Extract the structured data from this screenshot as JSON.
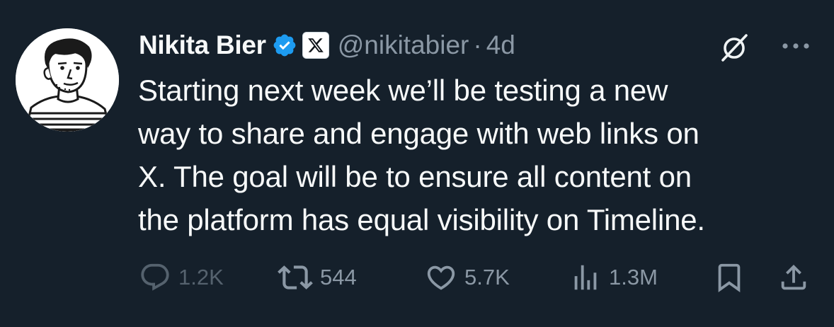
{
  "author": {
    "name": "Nikita Bier",
    "handle": "@nikitabier",
    "separator": "·",
    "time": "4d"
  },
  "icons": {
    "avatar": "avatar-illustration",
    "verified": "verified-badge-icon",
    "affiliate": "x-logo-icon",
    "grok": "grok-icon",
    "more": "more-icon"
  },
  "tweet": {
    "lines": [
      "Starting next week we’ll be testing a new",
      "way to share and engage with web links on",
      "X. The goal will be to ensure all content on",
      "the platform has equal visibility on Timeline."
    ]
  },
  "actions": {
    "replies": "1.2K",
    "retweets": "544",
    "likes": "5.7K",
    "views": "1.3M"
  },
  "colors": {
    "background": "#15202b",
    "text": "#f7f9f9",
    "secondary": "#8b98a5",
    "verified": "#1d9bf0"
  }
}
